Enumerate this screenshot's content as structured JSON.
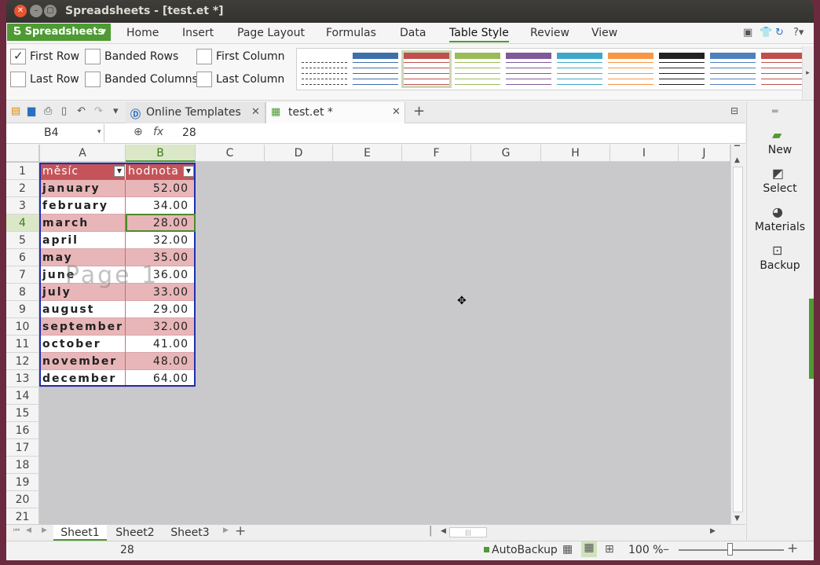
{
  "window": {
    "title": "Spreadsheets - [test.et *]"
  },
  "app_button": {
    "label": "Spreadsheets"
  },
  "menu": [
    "Home",
    "Insert",
    "Page Layout",
    "Formulas",
    "Data",
    "Table Style",
    "Review",
    "View"
  ],
  "menu_active": "Table Style",
  "ribbon": {
    "checkboxes": [
      {
        "label": "First Row",
        "checked": true
      },
      {
        "label": "Banded Rows",
        "checked": false
      },
      {
        "label": "First Column",
        "checked": false
      },
      {
        "label": "Last Row",
        "checked": false
      },
      {
        "label": "Banded Columns",
        "checked": false
      },
      {
        "label": "Last Column",
        "checked": false
      }
    ],
    "style_colors": [
      "#555555",
      "#3d6fa8",
      "#c0504d",
      "#9bbb59",
      "#7e5a9b",
      "#3fa8c9",
      "#f79646",
      "#222222",
      "#4f81bd",
      "#c0504d"
    ]
  },
  "tabs": {
    "templates": "Online Templates",
    "file": "test.et *"
  },
  "formula": {
    "cell_ref": "B4",
    "fx": "fx",
    "value": "28"
  },
  "grid": {
    "columns": [
      "A",
      "B",
      "C",
      "D",
      "E",
      "F",
      "G",
      "H",
      "I",
      "J"
    ],
    "rows": [
      "1",
      "2",
      "3",
      "4",
      "5",
      "6",
      "7",
      "8",
      "9",
      "10",
      "11",
      "12",
      "13",
      "14",
      "15",
      "16",
      "17",
      "18",
      "19",
      "20",
      "21"
    ],
    "header": {
      "col_a": "měsíc",
      "col_b": "hodnota"
    },
    "data": [
      {
        "month": "january",
        "value": "52.00"
      },
      {
        "month": "february",
        "value": "34.00"
      },
      {
        "month": "march",
        "value": "28.00"
      },
      {
        "month": "april",
        "value": "32.00"
      },
      {
        "month": "may",
        "value": "35.00"
      },
      {
        "month": "june",
        "value": "36.00"
      },
      {
        "month": "july",
        "value": "33.00"
      },
      {
        "month": "august",
        "value": "29.00"
      },
      {
        "month": "september",
        "value": "32.00"
      },
      {
        "month": "october",
        "value": "41.00"
      },
      {
        "month": "november",
        "value": "48.00"
      },
      {
        "month": "december",
        "value": "64.00"
      }
    ],
    "watermark": "Page 1",
    "active_cell": "B4"
  },
  "sheets": [
    "Sheet1",
    "Sheet2",
    "Sheet3"
  ],
  "active_sheet": "Sheet1",
  "status": {
    "value": "28",
    "autobackup": "AutoBackup",
    "zoom": "100 %"
  },
  "side_panel": [
    "New",
    "Select",
    "Materials",
    "Backup"
  ],
  "colors": {
    "accent": "#4e9a33",
    "header_fill": "#c45459",
    "band_fill": "#e8b6b8",
    "table_border": "#1f2fb0"
  }
}
